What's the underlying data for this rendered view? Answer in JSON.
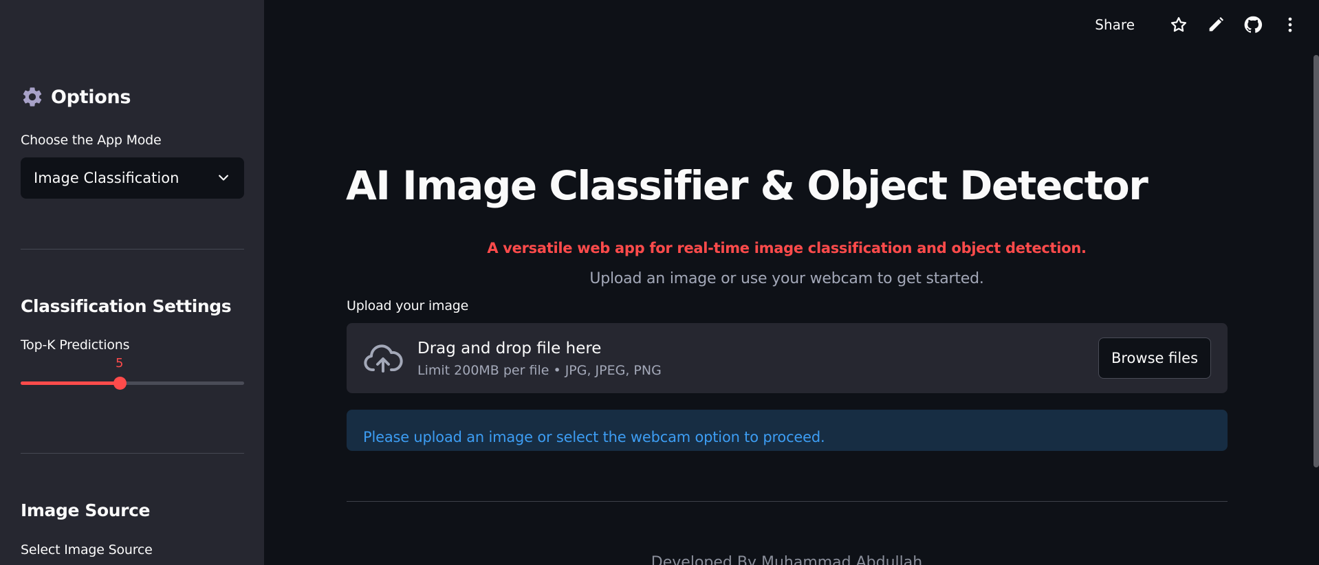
{
  "sidebar": {
    "header": "Options",
    "app_mode_label": "Choose the App Mode",
    "app_mode_value": "Image Classification",
    "classification_title": "Classification Settings",
    "topk_label": "Top-K Predictions",
    "topk_value": "5",
    "topk_fraction": 0.444,
    "image_source_title": "Image Source",
    "select_source_label": "Select Image Source"
  },
  "topbar": {
    "share_label": "Share",
    "icons": [
      "star-icon",
      "pencil-icon",
      "github-icon",
      "more-vertical-icon"
    ]
  },
  "main": {
    "title": "AI Image Classifier & Object Detector",
    "tagline": "A versatile web app for real-time image classification and object detection.",
    "instructions": "Upload an image or use your webcam to get started.",
    "upload_label": "Upload your image",
    "dropzone_title": "Drag and drop file here",
    "dropzone_limits": "Limit 200MB per file • JPG, JPEG, PNG",
    "browse_label": "Browse files",
    "info_message": "Please upload an image or select the webcam option to proceed.",
    "footer": "Developed By Muhammad Abdullah"
  },
  "colors": {
    "accent": "#ff4b4b",
    "info_text": "#3d9df3",
    "info_bg": "#172d43",
    "background": "#0e1117",
    "sidebar_bg": "#262730"
  }
}
